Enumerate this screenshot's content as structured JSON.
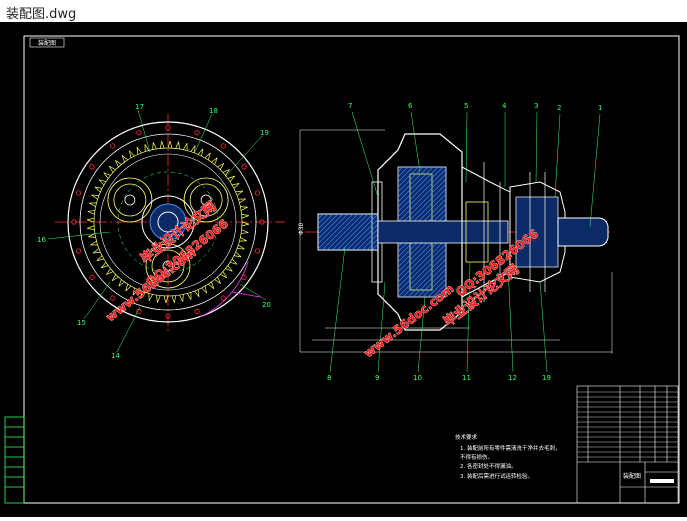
{
  "window": {
    "title": "装配图.dwg"
  },
  "drawing": {
    "top_left_tag": "装配图",
    "left_view_labels": [
      "17",
      "18",
      "19",
      "16",
      "15",
      "14",
      "20"
    ],
    "right_view_labels_top": [
      "7",
      "6",
      "5",
      "4",
      "3",
      "2",
      "1"
    ],
    "right_view_labels_bottom": [
      "8",
      "9",
      "10",
      "11",
      "12",
      "19"
    ],
    "dimension_left": "Φ30",
    "tech_requirements": {
      "title": "技术要求",
      "lines": [
        "1. 装配前所有零件需清洗干净并去毛刺，",
        "   不得有损伤。",
        "2. 各密封处不得漏油。",
        "3. 装配后需进行试运转检验。"
      ]
    },
    "title_block_name": "装配图"
  },
  "watermarks": [
    {
      "text": "毕业设计论文网"
    },
    {
      "text": "QQ:306826066"
    },
    {
      "text": "www.56doc.com"
    }
  ],
  "colors": {
    "background": "#000000",
    "outline": "#ffffff",
    "centerline": "#ff2a2a",
    "gear": "#ffff66",
    "hatch": "#3a8cff",
    "label": "#33ff66",
    "magenta": "#ff33ff",
    "watermark": "#ff1a1a"
  }
}
